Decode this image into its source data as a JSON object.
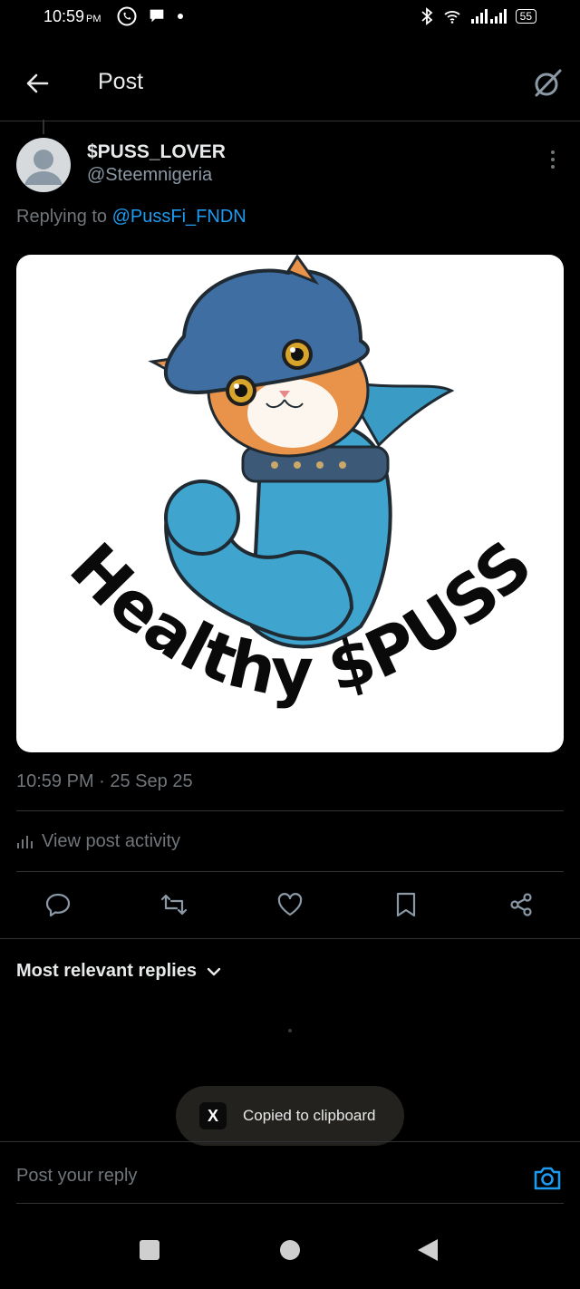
{
  "status_bar": {
    "time": "10:59",
    "ampm": "PM",
    "battery": "55"
  },
  "header": {
    "title": "Post"
  },
  "post": {
    "display_name": "$PUSS_LOVER",
    "handle": "@Steemnigeria",
    "replying_prefix": "Replying to ",
    "replying_to": "@PussFi_FNDN",
    "image_text": "Healthy $PUSS",
    "timestamp": "10:59 PM · 25 Sep 25",
    "activity_label": "View post activity"
  },
  "actions": [
    "reply-icon",
    "repost-icon",
    "like-icon",
    "bookmark-icon",
    "share-icon"
  ],
  "replies": {
    "sort_label": "Most relevant replies"
  },
  "toast": {
    "icon_letter": "X",
    "text": "Copied to clipboard"
  },
  "composer": {
    "placeholder": "Post your reply"
  },
  "colors": {
    "accent": "#1d9bf0",
    "background": "#000000",
    "muted": "#71767b",
    "divider": "#2f3336"
  }
}
